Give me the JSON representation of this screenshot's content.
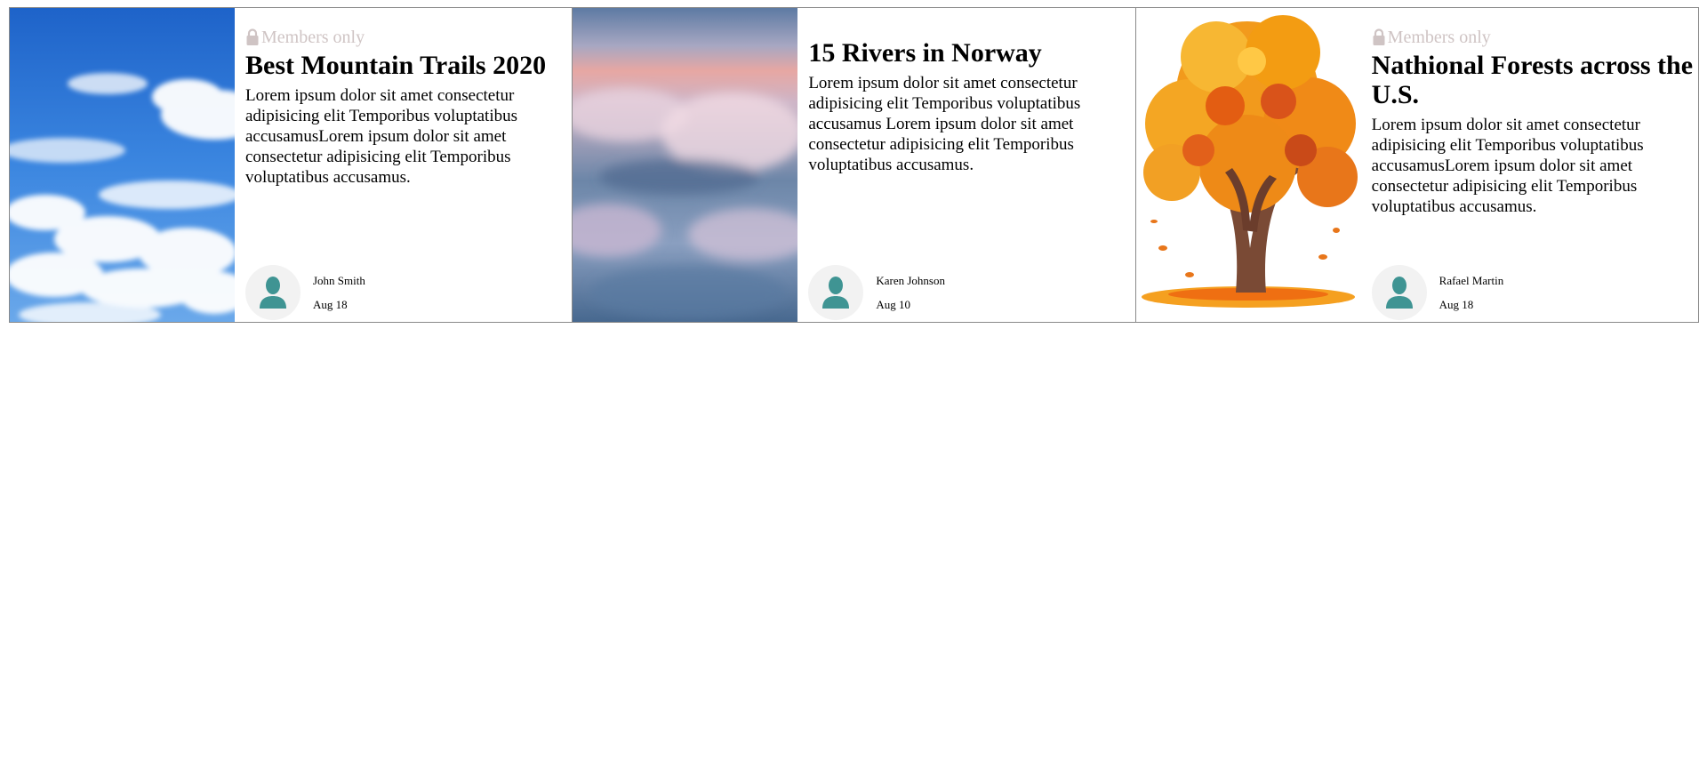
{
  "cards": [
    {
      "badge": "Members only",
      "title": "Best Mountain Trails 2020",
      "text": "Lorem ipsum dolor sit amet consectetur adipisicing elit Temporibus voluptatibus accusamusLorem ipsum dolor sit amet consectetur adipisicing elit Temporibus voluptatibus accusamus.",
      "author": "John Smith",
      "date": "Aug 18"
    },
    {
      "title": "15 Rivers in Norway",
      "text": "Lorem ipsum dolor sit amet consectetur adipisicing elit Temporibus voluptatibus accusamus Lorem ipsum dolor sit amet consectetur adipisicing elit Temporibus voluptatibus accusamus.",
      "author": "Karen Johnson",
      "date": "Aug 10"
    },
    {
      "badge": "Members only",
      "title": "Nathional Forests across the U.S.",
      "text": "Lorem ipsum dolor sit amet consectetur adipisicing elit Temporibus voluptatibus accusamusLorem ipsum dolor sit amet consectetur adipisicing elit Temporibus voluptatibus accusamus.",
      "author": "Rafael Martin",
      "date": "Aug 18"
    }
  ],
  "icons": {
    "lock": "lock-icon",
    "avatar": "user-icon"
  },
  "colors": {
    "badge_text": "#cfc4c4",
    "avatar_figure": "#3f9493",
    "avatar_bg": "#f2f2f2",
    "card_border": "#8a8a8a"
  }
}
